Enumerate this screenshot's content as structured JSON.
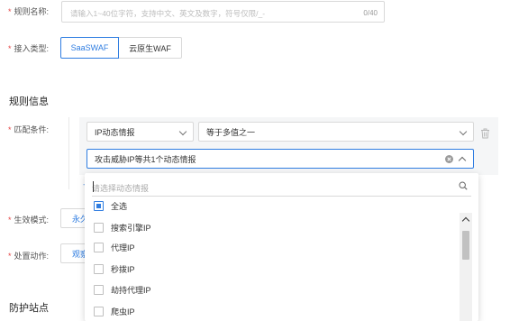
{
  "form": {
    "rule_name": {
      "label": "规则名称:",
      "placeholder": "请输入1~40位字符，支持中文、英文及数字，符号仅限/_-",
      "counter": "0/40"
    },
    "access_type": {
      "label": "接入类型:",
      "options": [
        "SaaSWAF",
        "云原生WAF"
      ],
      "selected": "SaaSWAF"
    },
    "rule_info_title": "规则信息",
    "match_condition": {
      "label": "匹配条件:",
      "field_select": "IP动态情报",
      "operator_select": "等于多值之一",
      "value_select": "攻击威胁IP等共1个动态情报"
    },
    "effect_mode": {
      "label": "生效模式:",
      "button": "永久"
    },
    "action": {
      "label": "处置动作:",
      "button": "观察"
    },
    "protect_site_title": "防护站点"
  },
  "dropdown": {
    "search_placeholder": "请选择动态情报",
    "items": [
      {
        "label": "全选",
        "state": "indeterminate"
      },
      {
        "label": "搜索引擎IP",
        "state": "unchecked"
      },
      {
        "label": "代理IP",
        "state": "unchecked"
      },
      {
        "label": "秒拨IP",
        "state": "unchecked"
      },
      {
        "label": "劫持代理IP",
        "state": "unchecked"
      },
      {
        "label": "爬虫IP",
        "state": "unchecked"
      }
    ]
  },
  "colors": {
    "accent": "#2f7de1",
    "required": "#e54545",
    "condition_bg": "#f5f6f7"
  },
  "icons": [
    "chevron-down-icon",
    "chevron-up-icon",
    "clear-icon",
    "trash-icon",
    "search-icon",
    "checkbox-icon"
  ]
}
